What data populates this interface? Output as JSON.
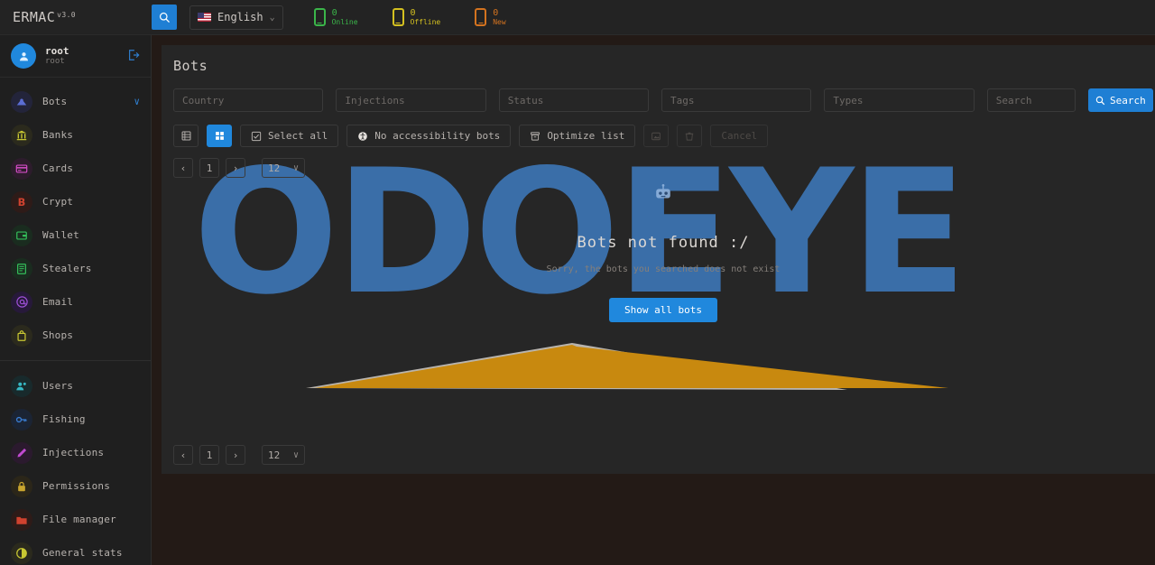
{
  "topbar": {
    "brand": "ERMAC",
    "version": "v3.0",
    "search_icon": "search-icon",
    "language": "English",
    "stats": [
      {
        "count": "0",
        "label": "Online",
        "color": "#3bb54a",
        "icon": "phone-icon"
      },
      {
        "count": "0",
        "label": "Offline",
        "color": "#d4c020",
        "icon": "phone-icon"
      },
      {
        "count": "0",
        "label": "New",
        "color": "#d4731f",
        "icon": "phone-icon"
      }
    ]
  },
  "sidebar": {
    "profile": {
      "name": "root",
      "role": "root",
      "logout_icon": "logout-icon",
      "avatar_icon": "user-icon"
    },
    "items": [
      {
        "label": "Bots",
        "icon": "bots-icon",
        "color": "#5b6ed4",
        "caret": "∨",
        "active": true
      },
      {
        "label": "Banks",
        "icon": "bank-icon",
        "color": "#c9c832"
      },
      {
        "label": "Cards",
        "icon": "card-icon",
        "color": "#d14bc4"
      },
      {
        "label": "Crypt",
        "icon": "bitcoin-icon",
        "color": "#d0422f"
      },
      {
        "label": "Wallet",
        "icon": "wallet-icon",
        "color": "#34bd5a"
      },
      {
        "label": "Stealers",
        "icon": "stealer-icon",
        "color": "#34bd5a"
      },
      {
        "label": "Email",
        "icon": "email-icon",
        "color": "#9b4fd4"
      },
      {
        "label": "Shops",
        "icon": "shop-icon",
        "color": "#c9c832"
      }
    ],
    "items2": [
      {
        "label": "Users",
        "icon": "users-icon",
        "color": "#36b8c4"
      },
      {
        "label": "Fishing",
        "icon": "key-icon",
        "color": "#3a7ed4"
      },
      {
        "label": "Injections",
        "icon": "injection-icon",
        "color": "#c04ad0"
      },
      {
        "label": "Permissions",
        "icon": "lock-icon",
        "color": "#c9a52e"
      },
      {
        "label": "File manager",
        "icon": "folder-icon",
        "color": "#d0422f"
      },
      {
        "label": "General stats",
        "icon": "pie-chart-icon",
        "color": "#c9c832"
      }
    ]
  },
  "page": {
    "title": "Bots",
    "watermark": "ODOEYE"
  },
  "filters": {
    "country": {
      "placeholder": "Country"
    },
    "injections": {
      "placeholder": "Injections"
    },
    "status": {
      "placeholder": "Status"
    },
    "tags": {
      "placeholder": "Tags"
    },
    "types": {
      "placeholder": "Types"
    },
    "search": {
      "placeholder": "Search"
    },
    "search_button": "Search",
    "search_button_icon": "search-icon"
  },
  "toolbar": {
    "list_view_icon": "list-view-icon",
    "grid_view_icon": "grid-view-icon",
    "select_all": "Select all",
    "select_all_icon": "checkbox-icon",
    "no_accessibility": "No accessibility bots",
    "no_accessibility_icon": "accessibility-icon",
    "optimize_list": "Optimize list",
    "optimize_list_icon": "archive-icon",
    "export_icon": "export-icon",
    "delete_icon": "trash-icon",
    "cancel": "Cancel"
  },
  "pagination": {
    "prev": "‹",
    "page": "1",
    "next": "›",
    "per_page": "12",
    "caret": "∨"
  },
  "empty_state": {
    "icon": "robot-icon",
    "title": "Bots not found :/",
    "subtitle": "Sorry, the bots you searched does not exist",
    "button": "Show all bots"
  },
  "colors": {
    "accent": "#2088dd",
    "panel": "#262626",
    "background": "#231a16",
    "sidebar": "#1f1f1f",
    "watermark_blue": "#3a6ea8",
    "watermark_gold": "#c8890f"
  }
}
